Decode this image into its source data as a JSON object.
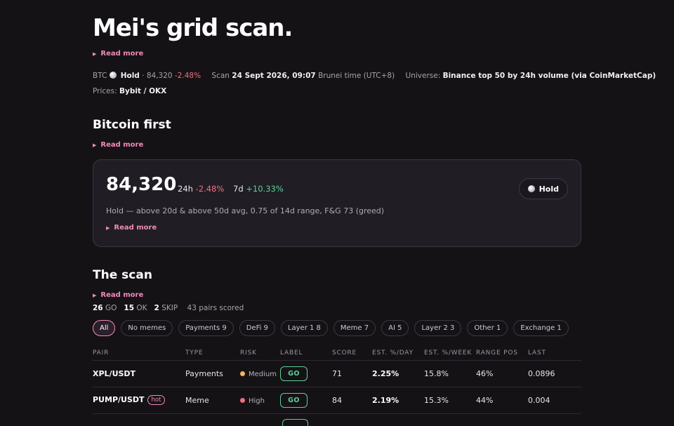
{
  "page": {
    "title": "Mei's grid scan.",
    "read_more": "Read more"
  },
  "meta": {
    "btc_label": "BTC",
    "btc_signal": "Hold",
    "btc_price": "· 84,320",
    "btc_change": "-2.48%",
    "scan_label": "Scan",
    "scan_time": "24 Sept 2026, 09:07",
    "scan_tz": "Brunei time (UTC+8)",
    "universe_label": "Universe:",
    "universe_value": "Binance top 50 by 24h volume (via CoinMarketCap)",
    "prices_label": "Prices:",
    "prices_value": "Bybit / OKX"
  },
  "bitcoin": {
    "heading": "Bitcoin first",
    "price": "84,320",
    "chg24_label": "24h",
    "chg24_value": "-2.48%",
    "chg7_label": "7d",
    "chg7_value": "+10.33%",
    "description": "Hold — above 20d & above 50d avg, 0.75 of 14d range, F&G 73 (greed)",
    "signal": "Hold"
  },
  "scan": {
    "heading": "The scan",
    "go_count": "26",
    "go_label": "GO",
    "ok_count": "15",
    "ok_label": "OK",
    "skip_count": "2",
    "skip_label": "SKIP",
    "pairs_scored": "43 pairs scored",
    "filters": [
      "All",
      "No memes",
      "Payments 9",
      "DeFi 9",
      "Layer 1 8",
      "Meme 7",
      "AI 5",
      "Layer 2 3",
      "Other 1",
      "Exchange 1"
    ],
    "columns": [
      "PAIR",
      "TYPE",
      "RISK",
      "LABEL",
      "SCORE",
      "EST. %/DAY",
      "EST. %/WEEK",
      "RANGE POS",
      "LAST"
    ],
    "rows": [
      {
        "pair": "XPL/USDT",
        "hot": "",
        "type": "Payments",
        "risk": "Medium",
        "label": "GO",
        "score": "71",
        "day": "2.25%",
        "week": "15.8%",
        "range": "46%",
        "last": "0.0896"
      },
      {
        "pair": "PUMP/USDT",
        "hot": "hot",
        "type": "Meme",
        "risk": "High",
        "label": "GO",
        "score": "84",
        "day": "2.19%",
        "week": "15.3%",
        "range": "44%",
        "last": "0.004"
      }
    ]
  },
  "colors": {
    "accent": "#f08ab8",
    "go": "#5cd196",
    "negative": "#ef6f7b",
    "risk_medium": "#f0b462",
    "risk_high": "#ef6f7b",
    "background": "#151216"
  },
  "icons": {
    "read_more": "triangle-right-icon",
    "btc_signal": "white-dot-icon"
  }
}
